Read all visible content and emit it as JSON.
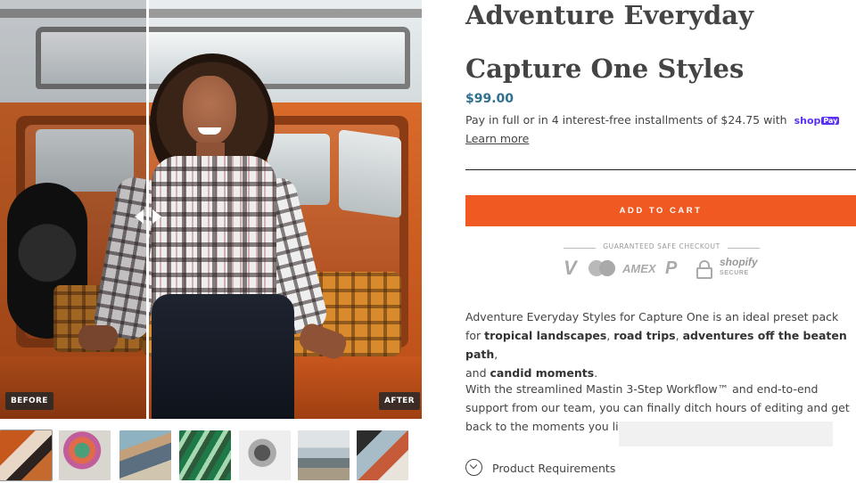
{
  "gallery": {
    "before_label": "BEFORE",
    "after_label": "AFTER",
    "thumbnail_count": 7
  },
  "product": {
    "title_line1": "Adventure Everyday",
    "title_line2": "Capture One Styles",
    "price": "$99.00",
    "installments_text": "Pay in full or in 4 interest-free installments of $24.75 with",
    "shop_pay_brand": "shop",
    "shop_pay_suffix": "Pay",
    "learn_more": "Learn more",
    "add_to_cart": "ADD TO CART"
  },
  "secure_checkout": {
    "label": "GUARANTEED SAFE CHECKOUT",
    "visa": "V",
    "amex": "AMEX",
    "paypal": "P",
    "shopify": "shopify",
    "shopify_sub": "SECURE"
  },
  "description": {
    "intro": "Adventure Everyday Styles for Capture One is an ideal preset pack for",
    "highlight_1": "tropical landscapes",
    "sep_1": ", ",
    "highlight_2": "road trips",
    "sep_2": ", ",
    "highlight_3": "adventures off the beaten path",
    "sep_3": ",",
    "and_text": "and ",
    "highlight_4": "candid moments",
    "end": ".",
    "para2": "With the streamlined Mastin 3-Step Workflow™ and end-to-end support from our team, you can finally ditch hours of editing and get back to the moments you li"
  },
  "accordion": {
    "requirements_label": "Product Requirements"
  },
  "colors": {
    "accent": "#f05a22",
    "price": "#2f6f8f",
    "shop_pay": "#5a31f4"
  }
}
